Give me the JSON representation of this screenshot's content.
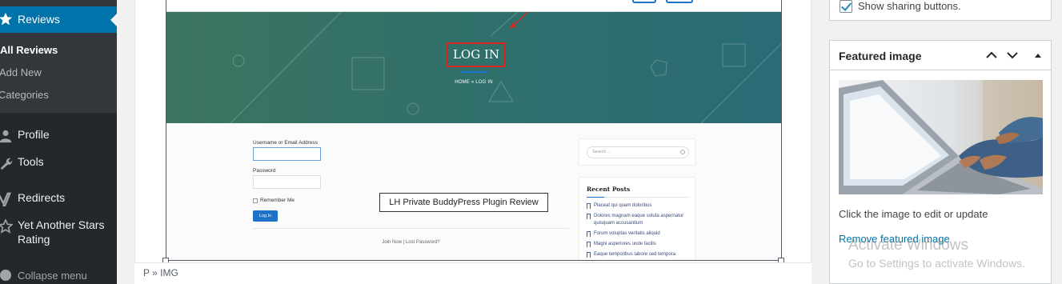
{
  "sidebar": {
    "active_menu": "Reviews",
    "submenu": [
      "All Reviews",
      "Add New",
      "Categories"
    ],
    "items": [
      "Profile",
      "Tools",
      "Redirects",
      "Yet Another Stars Rating"
    ],
    "collapse_label": "Collapse menu",
    "colors": {
      "bg": "#23282d",
      "active": "#0073aa"
    }
  },
  "embedded_page": {
    "hero_title": "LOG IN",
    "breadcrumb": "HOME  »  LOG IN",
    "form": {
      "username_label": "Username or Email Address",
      "password_label": "Password",
      "remember_label": "Remember Me",
      "login_button": "Log In",
      "join_links": "Join Now | Lost Password?"
    },
    "sidebar": {
      "search_placeholder": "Search ...",
      "recent_title": "Recent Posts",
      "recent_posts": [
        "Placeat qui quam doloribus",
        "Dolores magnam eaque soluta aspernatur quisquam accusantium",
        "Forum voluptas veritatis aliquid",
        "Magni asperiores unde facilis",
        "Eaque temporibus labore sed tempora"
      ]
    }
  },
  "caption": "LH Private BuddyPress Plugin Review",
  "editor_footer_path": "P » IMG",
  "share": {
    "label": "Show sharing buttons.",
    "checked": true
  },
  "featured_image": {
    "title": "Featured image",
    "edit_hint": "Click the image to edit or update",
    "remove_link": "Remove featured image"
  },
  "watermark": {
    "line1": "Activate Windows",
    "line2": "Go to Settings to activate Windows."
  }
}
